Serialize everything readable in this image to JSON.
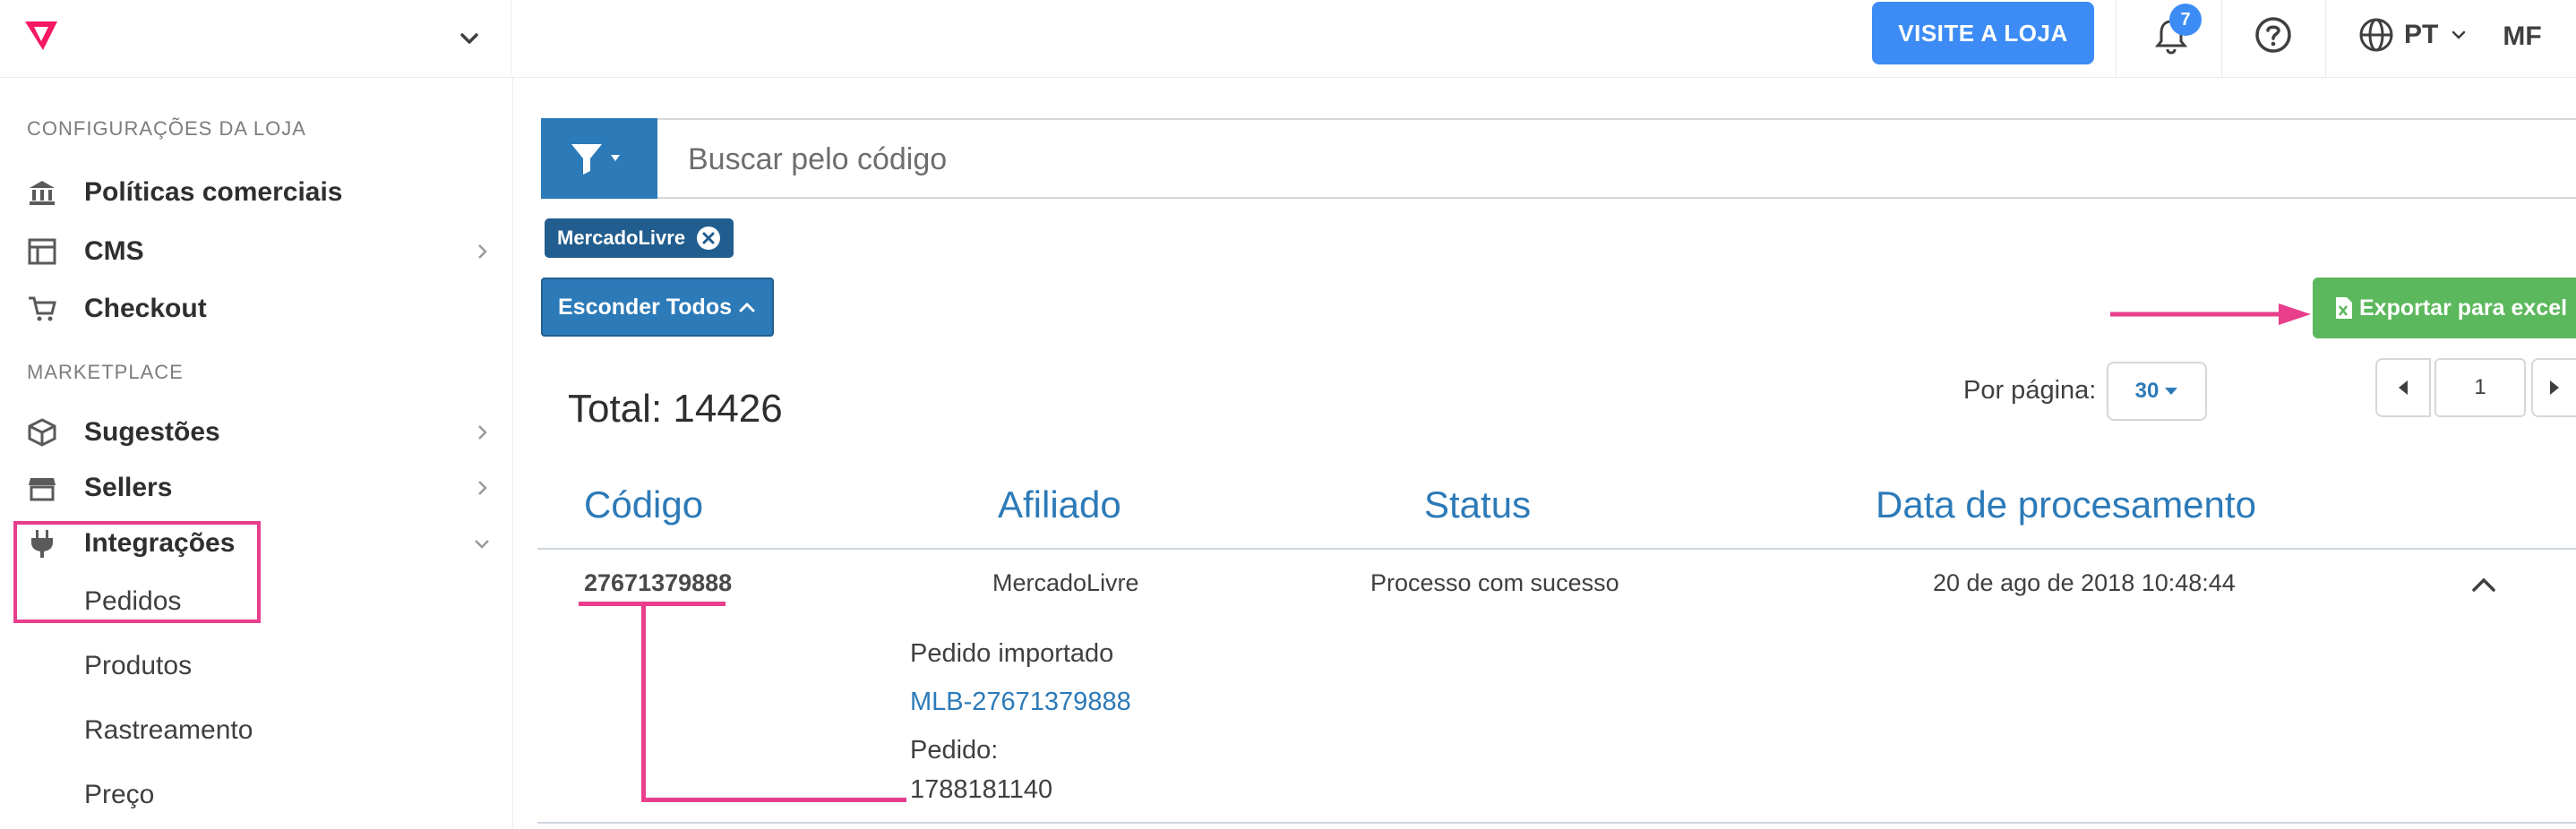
{
  "topbar": {
    "visit_label": "VISITE A LOJA",
    "notifications_count": "7",
    "language": "PT",
    "avatar_initials": "MF"
  },
  "sidebar": {
    "section_store": "CONFIGURAÇÕES DA LOJA",
    "section_marketplace": "MARKETPLACE",
    "items": [
      {
        "label": "Políticas comerciais",
        "icon": "bank-icon"
      },
      {
        "label": "CMS",
        "icon": "layout-icon"
      },
      {
        "label": "Checkout",
        "icon": "cart-icon"
      },
      {
        "label": "Sugestões",
        "icon": "box-icon"
      },
      {
        "label": "Sellers",
        "icon": "store-icon"
      },
      {
        "label": "Integrações",
        "icon": "plug-icon"
      }
    ],
    "subitems": [
      "Pedidos",
      "Produtos",
      "Rastreamento",
      "Preço"
    ]
  },
  "search": {
    "placeholder": "Buscar pelo código"
  },
  "filter_chip": "MercadoLivre",
  "hide_all_label": "Esconder Todos",
  "export_label": "Exportar para excel",
  "total_label": "Total: 14426",
  "per_page": {
    "label": "Por página:",
    "value": "30"
  },
  "pagination": {
    "page": "1"
  },
  "table": {
    "columns": [
      "Código",
      "Afiliado",
      "Status",
      "Data de procesamento"
    ],
    "rows": [
      {
        "code": "27671379888",
        "affiliate": "MercadoLivre",
        "status": "Processo com sucesso",
        "date": "20 de ago de 2018 10:48:44",
        "details": {
          "imported_label": "Pedido importado",
          "link": "MLB-27671379888",
          "order_label": "Pedido:",
          "order_value": "1788181140"
        }
      }
    ]
  },
  "colors": {
    "primary": "#2c7ab8",
    "visit_button": "#3d8cf5",
    "export_green": "#5cb85c",
    "annotation_pink": "#e83e8c"
  }
}
